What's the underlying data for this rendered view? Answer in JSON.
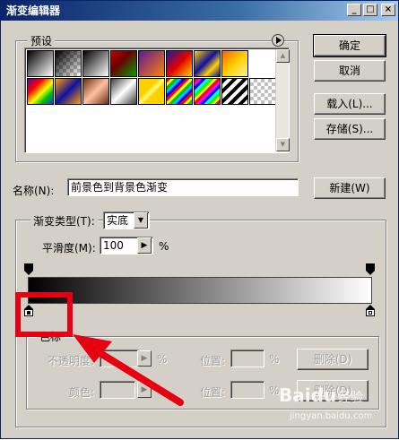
{
  "window": {
    "title": "渐变编辑器"
  },
  "titlebar_buttons": {
    "minimize": "_",
    "maximize": "□",
    "close": "×"
  },
  "presets": {
    "label": "预设"
  },
  "buttons": {
    "ok": "确定",
    "cancel": "取消",
    "load": "载入(L)...",
    "save": "存储(S)...",
    "new": "新建(W)",
    "delete_opacity": "删除(D)",
    "delete_color": "删除(D)"
  },
  "name": {
    "label": "名称(N):",
    "value": "前景色到背景色渐变"
  },
  "gradient_type": {
    "label": "渐变类型(T):",
    "value": "实底"
  },
  "smoothness": {
    "label": "平滑度(M):",
    "value": "100",
    "unit": "%"
  },
  "color_stops": {
    "label": "色标",
    "opacity_label": "不透明度:",
    "opacity_unit": "%",
    "location_label": "位置:",
    "location_unit": "%",
    "color_label": "颜色:",
    "location2_label": "位置:",
    "location2_unit": "%"
  },
  "watermark": {
    "brand": "Baidu",
    "sub": "经验",
    "url": "jingyan.baidu.com"
  },
  "colors": {
    "title_start": "#0a246a",
    "title_end": "#a6caf0",
    "face": "#d4d0c8",
    "highlight": "#e60012"
  },
  "icons": {
    "flyout_menu": "circle-arrow-right-icon",
    "scroll_up": "triangle-up-icon",
    "scroll_down": "triangle-down-icon",
    "dropdown": "triangle-down-icon",
    "stepper": "triangle-right-icon"
  }
}
